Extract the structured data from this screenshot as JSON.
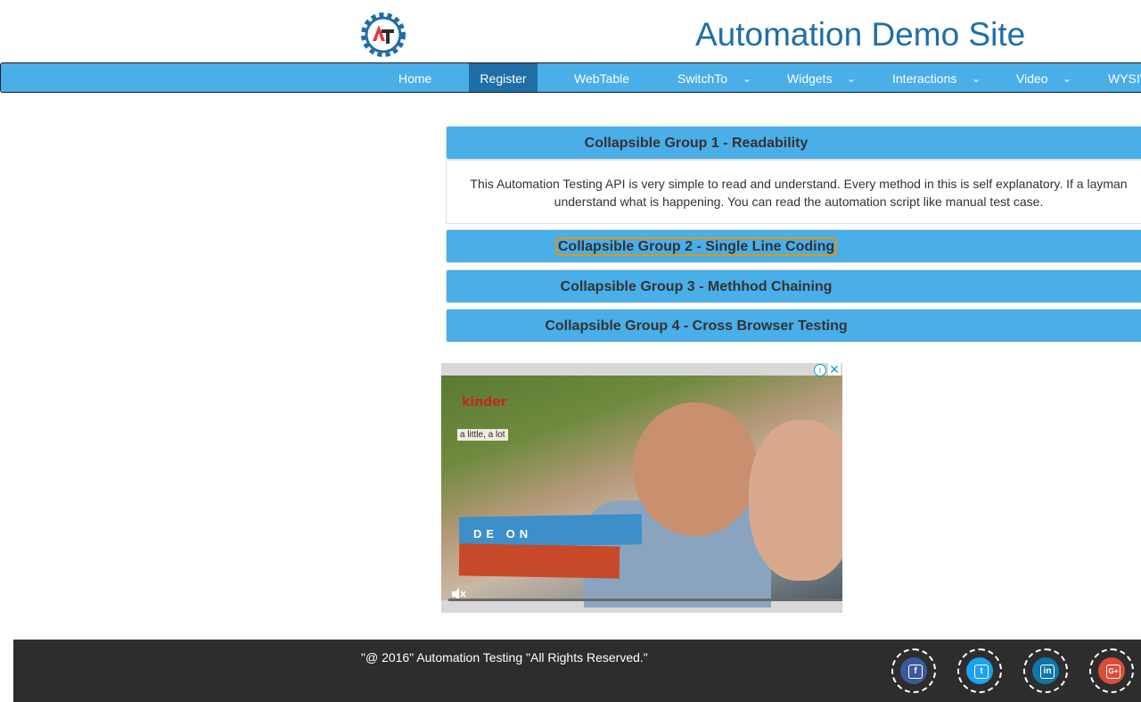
{
  "site": {
    "title": "Automation Demo Site",
    "logo_text": "AT",
    "colors": {
      "brand_blue": "#1f6ea8",
      "nav_blue": "#4aaee8",
      "footer": "#2d2d2d"
    }
  },
  "nav": {
    "items": [
      {
        "label": "Home",
        "has_dropdown": false
      },
      {
        "label": "Register",
        "has_dropdown": false,
        "active": true
      },
      {
        "label": "WebTable",
        "has_dropdown": false
      },
      {
        "label": "SwitchTo",
        "has_dropdown": true
      },
      {
        "label": "Widgets",
        "has_dropdown": true
      },
      {
        "label": "Interactions",
        "has_dropdown": true
      },
      {
        "label": "Video",
        "has_dropdown": true
      },
      {
        "label": "WYSIWYG",
        "has_dropdown": false
      }
    ],
    "chevron": "⌄"
  },
  "accordion": {
    "groups": [
      {
        "label": "Collapsible Group 1 - Readability",
        "expanded": true,
        "body_line1": "This Automation Testing API is very simple to read and understand. Every method in this is self explanatory. If a layman",
        "body_line2": "understand what is happening. You can read the automation script like manual test case."
      },
      {
        "label": "Collapsible Group 2 - Single Line Coding",
        "expanded": false,
        "focused": true
      },
      {
        "label": "Collapsible Group 3 - Methhod Chaining",
        "expanded": false
      },
      {
        "label": "Collapsible Group 4 - Cross Browser Testing",
        "expanded": false
      }
    ]
  },
  "ad": {
    "brand": "kinder",
    "tagline": "a little, a lot",
    "band_text": "DE ON",
    "info_icon": "info-icon",
    "close_symbol": "✕",
    "mute_symbol": "🔇"
  },
  "footer": {
    "copyright": "\"@ 2016\" Automation Testing \"All Rights Reserved.\"",
    "social": [
      {
        "name": "facebook-icon",
        "glyph": "f",
        "color": "#3b5998"
      },
      {
        "name": "twitter-icon",
        "glyph": "t",
        "color": "#1da1f2"
      },
      {
        "name": "linkedin-icon",
        "glyph": "in",
        "color": "#0e76a8"
      },
      {
        "name": "google-plus-icon",
        "glyph": "G+",
        "color": "#dd4b39"
      }
    ]
  }
}
